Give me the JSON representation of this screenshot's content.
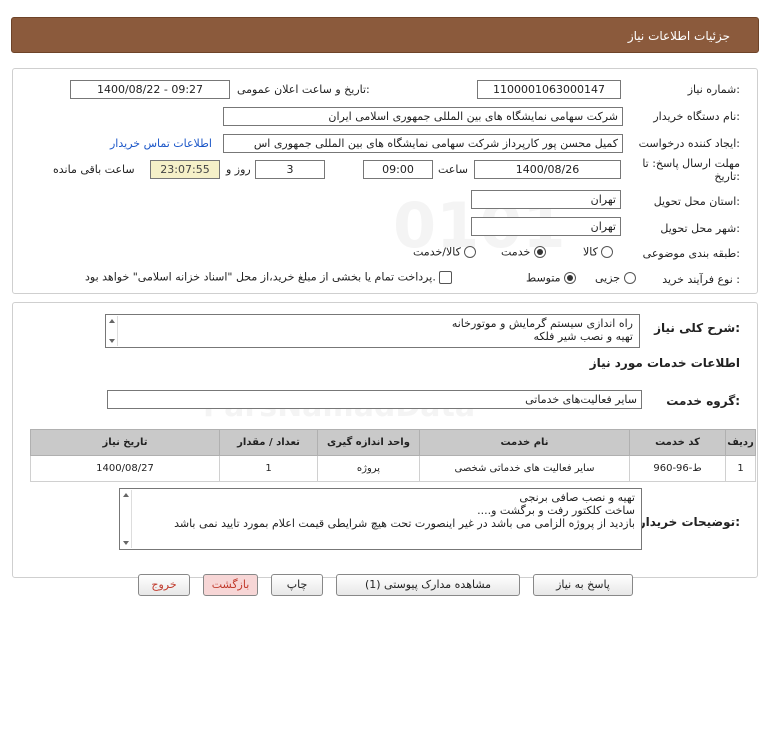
{
  "header": {
    "title": "جزئیات اطلاعات نیاز"
  },
  "form": {
    "need_number": {
      "label": "شماره نیاز:",
      "value": "1100001063000147"
    },
    "announce_datetime": {
      "label": "تاریخ و ساعت اعلان عمومی:",
      "value": "1400/08/22 - 09:27"
    },
    "buyer_org": {
      "label": "نام دستگاه خریدار:",
      "value": "شرکت سهامی نمایشگاه های بین المللی جمهوری اسلامی ایران"
    },
    "creator": {
      "label": "ایجاد کننده درخواست:",
      "value": "کمیل محسن پور کارپرداز شرکت سهامی نمایشگاه های بین المللی جمهوری اس",
      "contact_link": "اطلاعات تماس خریدار"
    },
    "deadline": {
      "label": "مهلت ارسال پاسخ: تا تاریخ:",
      "date": "1400/08/26",
      "time_label": "ساعت",
      "time": "09:00",
      "days": "3",
      "days_label": "روز و",
      "remaining": "23:07:55",
      "remaining_label": "ساعت باقی مانده"
    },
    "province": {
      "label": "استان محل تحویل:",
      "value": "تهران"
    },
    "city": {
      "label": "شهر محل تحویل:",
      "value": "تهران"
    },
    "category": {
      "label": "طبقه بندی موضوعی:",
      "options": [
        "کالا",
        "خدمت",
        "کالا/خدمت"
      ],
      "selected": "خدمت"
    },
    "process": {
      "label": "نوع فرآیند خرید :",
      "options": [
        "جزیی",
        "متوسط"
      ],
      "selected": "متوسط",
      "checkbox_text": "پرداخت تمام یا بخشی از مبلغ خرید،از محل \"اسناد خزانه اسلامی\" خواهد بود."
    }
  },
  "summary": {
    "label": "شرح کلی نیاز:",
    "line1": "راه اندازی سیستم گرمایش و موتورخانه",
    "line2": "تهیه و نصب شیر فلکه"
  },
  "services": {
    "section_title": "اطلاعات خدمات مورد نیاز",
    "group_label": "گروه خدمت:",
    "group_value": "سایر فعالیت‌های خدماتی",
    "table": {
      "headers": [
        "ردیف",
        "کد خدمت",
        "نام خدمت",
        "واحد اندازه گیری",
        "تعداد / مقدار",
        "تاریخ نیاز"
      ],
      "rows": [
        [
          "1",
          "ط-96-960",
          "سایر فعالیت های خدماتی شخصی",
          "پروژه",
          "1",
          "1400/08/27"
        ]
      ]
    }
  },
  "buyer_notes": {
    "label": "توضیحات خریدار:",
    "line1": "تهیه و نصب صافی برنجی",
    "line2": "ساخت کلکتور رفت و برگشت و....",
    "line3": "بازدید از پروژه الزامی می باشد در غیر اینصورت تحت هیچ شرایطی قیمت اعلام بمورد تایید نمی باشد"
  },
  "buttons": {
    "reply": "پاسخ به نیاز",
    "attachments": "مشاهده مدارک پیوستی (1)",
    "print": "چاپ",
    "back": "بازگشت",
    "exit": "خروج"
  }
}
